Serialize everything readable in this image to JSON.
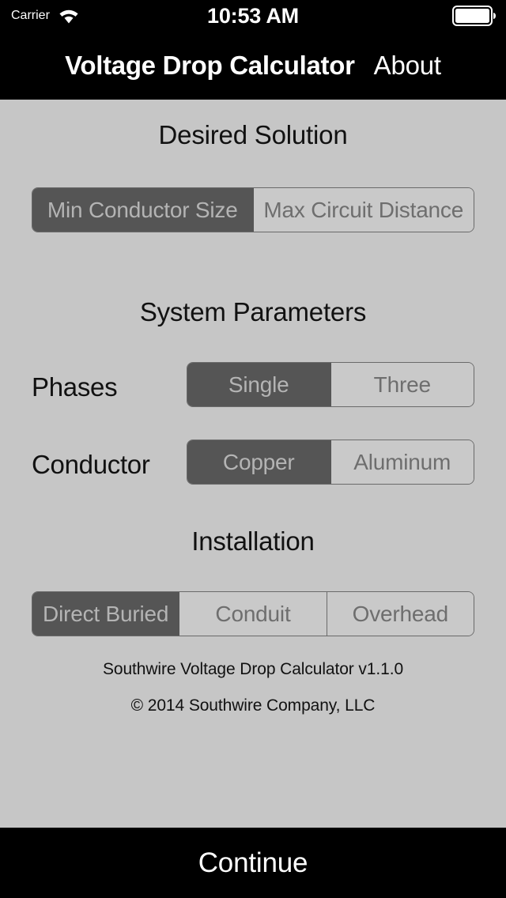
{
  "status_bar": {
    "carrier": "Carrier",
    "wifi_icon": "wifi-icon",
    "time": "10:53 AM",
    "battery_icon": "battery-full-icon"
  },
  "nav_bar": {
    "title": "Voltage Drop Calculator",
    "about_label": "About"
  },
  "sections": {
    "desired_solution": {
      "header": "Desired Solution",
      "options": [
        {
          "label": "Min Conductor Size",
          "selected": true
        },
        {
          "label": "Max Circuit Distance",
          "selected": false
        }
      ]
    },
    "system_parameters": {
      "header": "System Parameters",
      "phases": {
        "label": "Phases",
        "options": [
          {
            "label": "Single",
            "selected": true
          },
          {
            "label": "Three",
            "selected": false
          }
        ]
      },
      "conductor": {
        "label": "Conductor",
        "options": [
          {
            "label": "Copper",
            "selected": true
          },
          {
            "label": "Aluminum",
            "selected": false
          }
        ]
      }
    },
    "installation": {
      "header": "Installation",
      "options": [
        {
          "label": "Direct Buried",
          "selected": true
        },
        {
          "label": "Conduit",
          "selected": false
        },
        {
          "label": "Overhead",
          "selected": false
        }
      ]
    }
  },
  "footer": {
    "version_line": "Southwire Voltage Drop Calculator v1.1.0",
    "copyright_line": "© 2014 Southwire Company, LLC"
  },
  "bottom_bar": {
    "continue_label": "Continue"
  },
  "colors": {
    "page_background": "#c6c6c6",
    "bar_background": "#000000",
    "segment_selected_background": "#555555",
    "segment_selected_text": "#b4b4b4",
    "segment_unselected_background": "#c9c9c9",
    "segment_unselected_text": "#6e6e6e",
    "segment_border": "#6a6a6a",
    "text_primary": "#111111",
    "text_on_dark": "#ffffff"
  }
}
